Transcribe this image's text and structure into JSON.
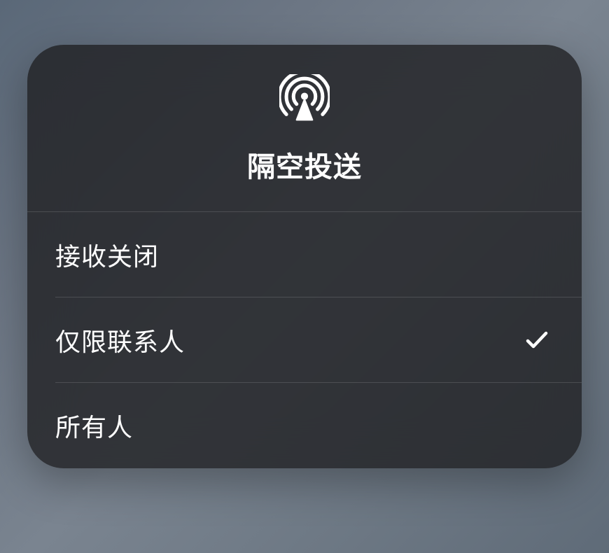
{
  "header": {
    "title": "隔空投送",
    "icon_name": "airdrop-icon"
  },
  "options": [
    {
      "label": "接收关闭",
      "selected": false
    },
    {
      "label": "仅限联系人",
      "selected": true
    },
    {
      "label": "所有人",
      "selected": false
    }
  ]
}
